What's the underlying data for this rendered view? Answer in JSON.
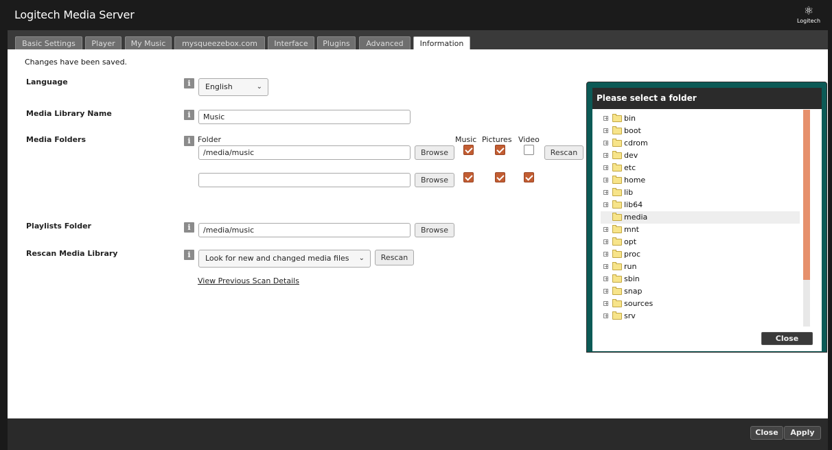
{
  "app": {
    "brand": "Logitech",
    "name": " Media Server",
    "logo_text": "Logitech"
  },
  "tabs": [
    {
      "label": "Basic Settings",
      "active": false
    },
    {
      "label": "Player",
      "active": false
    },
    {
      "label": "My Music",
      "active": false
    },
    {
      "label": "mysqueezebox.com",
      "active": false
    },
    {
      "label": "Interface",
      "active": false
    },
    {
      "label": "Plugins",
      "active": false
    },
    {
      "label": "Advanced",
      "active": false
    },
    {
      "label": "Information",
      "active": true
    }
  ],
  "status": "Changes have been saved.",
  "language": {
    "label": "Language",
    "value": "English"
  },
  "library_name": {
    "label": "Media Library Name",
    "value": "Music"
  },
  "media_folders": {
    "label": "Media Folders",
    "col_folder": "Folder",
    "col_music": "Music",
    "col_pictures": "Pictures",
    "col_video": "Video",
    "browse_label": "Browse",
    "rescan_label": "Rescan",
    "rows": [
      {
        "path": "/media/music",
        "music": true,
        "pictures": true,
        "video": false
      },
      {
        "path": "",
        "music": true,
        "pictures": true,
        "video": true
      }
    ]
  },
  "playlists": {
    "label": "Playlists Folder",
    "value": "/media/music",
    "browse_label": "Browse"
  },
  "rescan": {
    "label": "Rescan Media Library",
    "option": "Look for new and changed media files",
    "button": "Rescan",
    "details_link": "View Previous Scan Details"
  },
  "dialog": {
    "title": "Please select a folder",
    "close_label": "Close",
    "folders": [
      {
        "name": "bin",
        "expandable": true,
        "selected": false
      },
      {
        "name": "boot",
        "expandable": true,
        "selected": false
      },
      {
        "name": "cdrom",
        "expandable": true,
        "selected": false
      },
      {
        "name": "dev",
        "expandable": true,
        "selected": false
      },
      {
        "name": "etc",
        "expandable": true,
        "selected": false
      },
      {
        "name": "home",
        "expandable": true,
        "selected": false
      },
      {
        "name": "lib",
        "expandable": true,
        "selected": false
      },
      {
        "name": "lib64",
        "expandable": true,
        "selected": false
      },
      {
        "name": "media",
        "expandable": false,
        "selected": true
      },
      {
        "name": "mnt",
        "expandable": true,
        "selected": false
      },
      {
        "name": "opt",
        "expandable": true,
        "selected": false
      },
      {
        "name": "proc",
        "expandable": true,
        "selected": false
      },
      {
        "name": "run",
        "expandable": true,
        "selected": false
      },
      {
        "name": "sbin",
        "expandable": true,
        "selected": false
      },
      {
        "name": "snap",
        "expandable": true,
        "selected": false
      },
      {
        "name": "sources",
        "expandable": true,
        "selected": false
      },
      {
        "name": "srv",
        "expandable": true,
        "selected": false
      }
    ]
  },
  "footer": {
    "close_label": "Close",
    "apply_label": "Apply"
  }
}
